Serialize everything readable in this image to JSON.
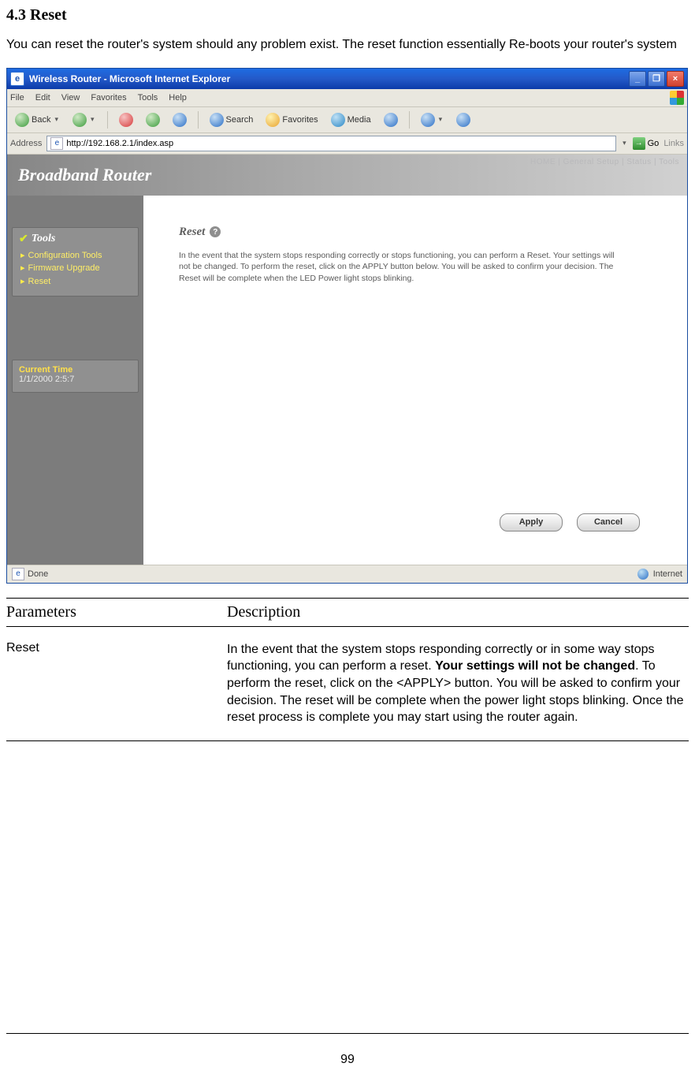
{
  "doc": {
    "section_title": "4.3 Reset",
    "intro": "You can reset the router's system should any problem exist. The reset function essentially Re-boots your router's system",
    "page_number": "99"
  },
  "screenshot": {
    "window_title": "Wireless Router - Microsoft Internet Explorer",
    "menu": {
      "file": "File",
      "edit": "Edit",
      "view": "View",
      "favorites": "Favorites",
      "tools": "Tools",
      "help": "Help"
    },
    "toolbar": {
      "back": "Back",
      "search": "Search",
      "favorites": "Favorites",
      "media": "Media"
    },
    "address": {
      "label": "Address",
      "value": "http://192.168.2.1/index.asp",
      "go": "Go",
      "links": "Links"
    },
    "router": {
      "brand": "Broadband Router",
      "top_links": "HOME | General Setup | Status | Tools",
      "sidebar": {
        "group_title": "Tools",
        "items": [
          "Configuration Tools",
          "Firmware Upgrade",
          "Reset"
        ],
        "time_label": "Current Time",
        "time_value": "1/1/2000 2:5:7"
      },
      "content": {
        "title": "Reset",
        "text": "In the event that the system stops responding correctly or stops functioning, you can perform a Reset. Your settings will not be changed. To perform the reset, click on the APPLY button below. You will be asked to confirm your decision. The Reset will be complete when the LED Power light stops blinking.",
        "apply": "Apply",
        "cancel": "Cancel"
      }
    },
    "status": {
      "left": "Done",
      "right": "Internet"
    }
  },
  "table": {
    "h1": "Parameters",
    "h2": "Description",
    "row_name": "Reset",
    "row_desc_1": "In the event that the system stops responding correctly or in some way stops functioning, you can perform a reset. ",
    "row_desc_bold": "Your settings will not be changed",
    "row_desc_2": ". To perform the reset, click on the <APPLY> button. You will be asked to confirm your decision. The reset will be complete when the power light stops blinking. Once the reset process is complete you may start using the router again."
  }
}
